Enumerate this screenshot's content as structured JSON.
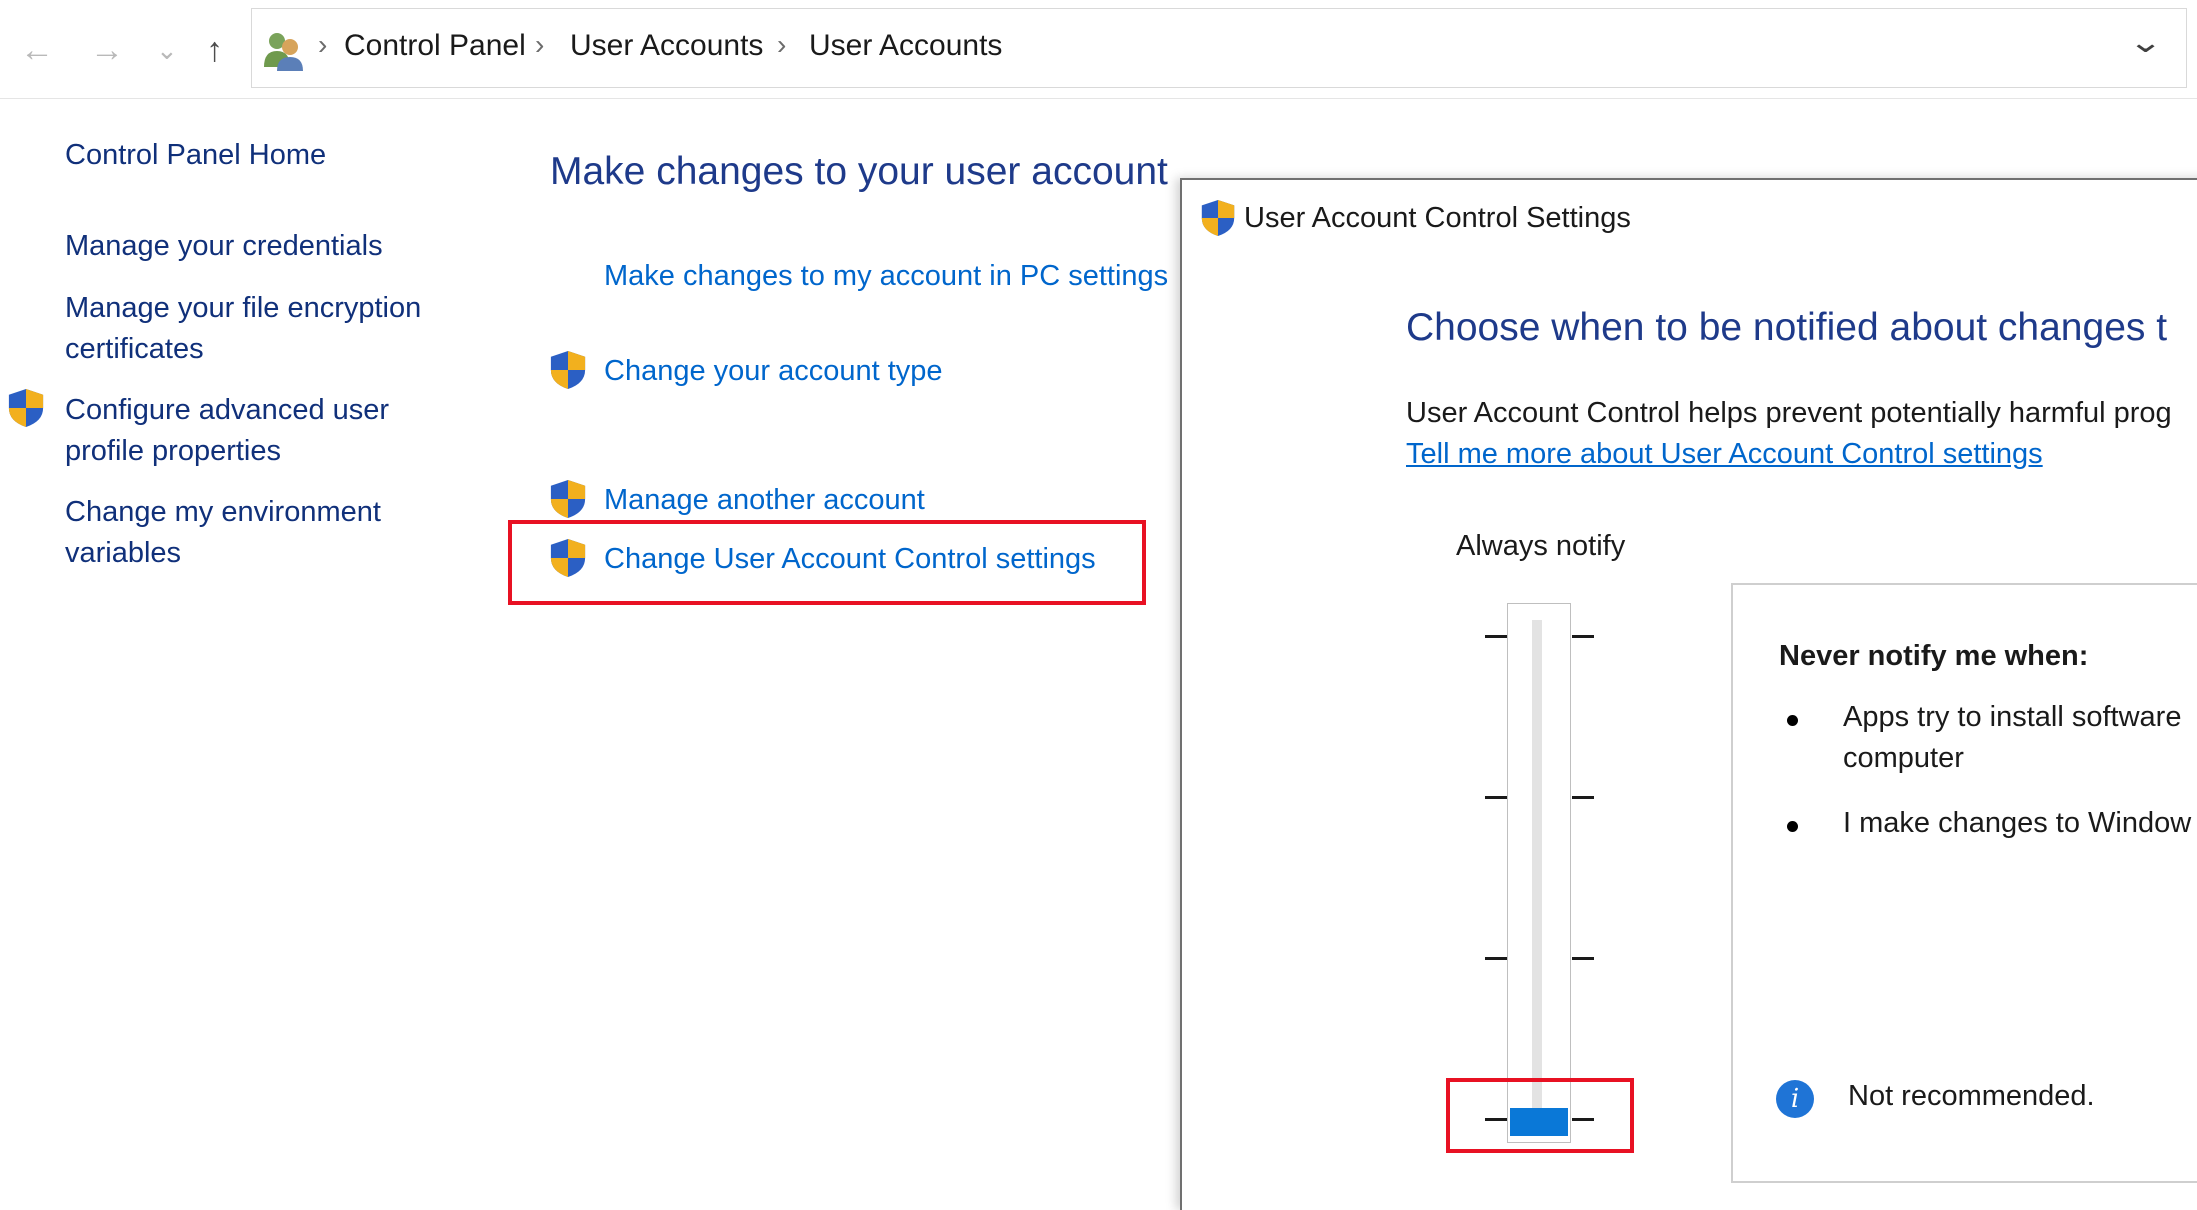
{
  "address_bar": {
    "breadcrumbs": [
      "Control Panel",
      "User Accounts",
      "User Accounts"
    ],
    "nav_icons": [
      "back-arrow-icon",
      "forward-arrow-icon",
      "recent-dropdown-icon",
      "up-arrow-icon"
    ]
  },
  "sidebar": {
    "home": "Control Panel Home",
    "items": [
      {
        "label_lines": [
          "Manage your credentials"
        ],
        "icon": null
      },
      {
        "label_lines": [
          "Manage your file encryption",
          "certificates"
        ],
        "icon": null
      },
      {
        "label_lines": [
          "Configure advanced user",
          "profile properties"
        ],
        "icon": "uac-shield-icon"
      },
      {
        "label_lines": [
          "Change my environment",
          "variables"
        ],
        "icon": null
      }
    ]
  },
  "main": {
    "title": "Make changes to your user account",
    "links": [
      {
        "label": "Make changes to my account in PC settings",
        "icon": null
      },
      {
        "label": "Change your account type",
        "icon": "uac-shield-icon"
      },
      {
        "label": "Manage another account",
        "icon": "uac-shield-icon"
      },
      {
        "label": "Change User Account Control settings",
        "icon": "uac-shield-icon",
        "highlighted": true
      }
    ]
  },
  "uac_dialog": {
    "title": "User Account Control Settings",
    "heading": "Choose when to be notified about changes t",
    "description": "User Account Control helps prevent potentially harmful prog",
    "learn_more_link": "Tell me more about User Account Control settings",
    "slider": {
      "top_label": "Always notify",
      "levels": 4,
      "selected_level": 1,
      "highlighted": true
    },
    "info_panel": {
      "heading": "Never notify me when:",
      "bullets": [
        {
          "lines": [
            "Apps try to install software",
            "computer"
          ]
        },
        {
          "lines": [
            "I make changes to Window"
          ]
        }
      ],
      "note": "Not recommended."
    }
  },
  "colors": {
    "link_blue": "#0066cc",
    "heading_blue": "#1e3a8a",
    "highlight_red": "#e81123",
    "slider_thumb": "#0a78d7"
  }
}
